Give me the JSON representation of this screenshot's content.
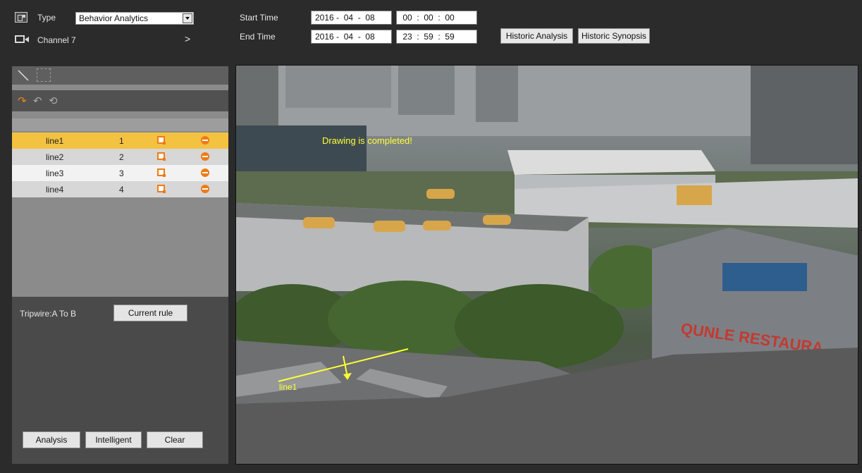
{
  "toolbar": {
    "type_label": "Type",
    "type_value": "Behavior Analytics",
    "channel_label": "Channel",
    "channel_value": "7",
    "channel_arrow": ">",
    "start_time_label": "Start Time",
    "end_time_label": "End Time",
    "start_date": "2016 -  04  -  08",
    "start_time": " 00  :  00  :  00",
    "end_date": "2016 -  04  -  08",
    "end_time": " 23  :  59  :  59",
    "historic_analysis": "Historic Analysis",
    "historic_synopsis": "Historic Synopsis"
  },
  "rules": {
    "rows": [
      {
        "name": "line1",
        "num": "1",
        "selected": true
      },
      {
        "name": "line2",
        "num": "2",
        "selected": false
      },
      {
        "name": "line3",
        "num": "3",
        "selected": false
      },
      {
        "name": "line4",
        "num": "4",
        "selected": false
      }
    ],
    "row_colors": {
      "selected": "#f3c240",
      "odd": "#f2f2f2",
      "even": "#d7d7d7"
    },
    "tripwire_label": "Tripwire:A To B",
    "current_rule_button": "Current rule"
  },
  "bottom_buttons": {
    "analysis": "Analysis",
    "intelligent": "Intelligent",
    "clear": "Clear"
  },
  "video": {
    "overlay_text": "Drawing is completed!",
    "line_label": "line1",
    "line_color": "#ffff33"
  },
  "icons": {
    "type": "type-icon",
    "camera": "camera-icon",
    "line_tool": "draw-line-icon",
    "rect_tool": "draw-rect-icon",
    "undo": "undo-icon",
    "edit": "edit-icon",
    "delete": "delete-icon"
  }
}
